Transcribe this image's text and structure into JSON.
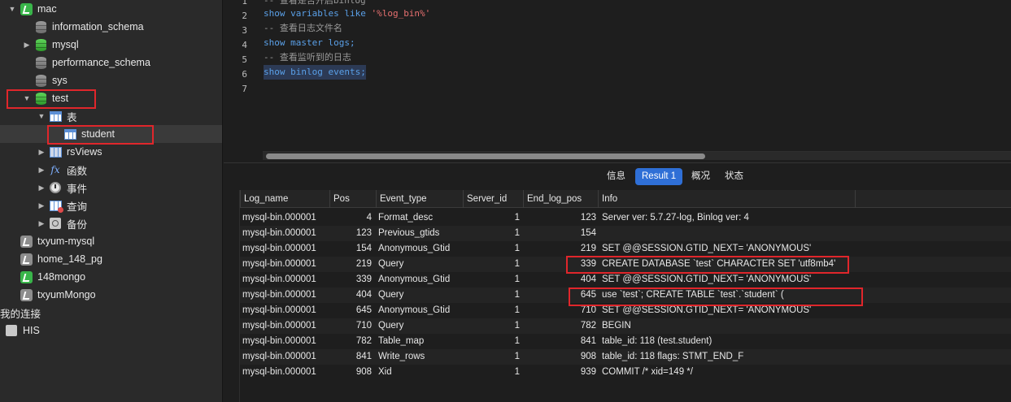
{
  "sidebar": {
    "items": [
      {
        "label": "mac",
        "disc": "▼",
        "icon": "conn-green"
      },
      {
        "label": "information_schema",
        "disc": "",
        "icon": "db-grey"
      },
      {
        "label": "mysql",
        "disc": "▶",
        "icon": "db-green"
      },
      {
        "label": "performance_schema",
        "disc": "",
        "icon": "db-grey"
      },
      {
        "label": "sys",
        "disc": "",
        "icon": "db-grey"
      },
      {
        "label": "test",
        "disc": "▼",
        "icon": "db-green"
      },
      {
        "label": "表",
        "disc": "▼",
        "icon": "table-icon"
      },
      {
        "label": "student",
        "disc": "",
        "icon": "table-icon"
      },
      {
        "label": "rsViews",
        "disc": "▶",
        "icon": "view-icon"
      },
      {
        "label": "函数",
        "disc": "▶",
        "icon": "function-icon"
      },
      {
        "label": "事件",
        "disc": "▶",
        "icon": "event-clock-icon"
      },
      {
        "label": "查询",
        "disc": "▶",
        "icon": "query-icon"
      },
      {
        "label": "备份",
        "disc": "▶",
        "icon": "backup-icon"
      },
      {
        "label": "txyum-mysql",
        "disc": "",
        "icon": "conn-grey"
      },
      {
        "label": "home_148_pg",
        "disc": "",
        "icon": "conn-grey"
      },
      {
        "label": "148mongo",
        "disc": "",
        "icon": "conn-green"
      },
      {
        "label": "txyumMongo",
        "disc": "",
        "icon": "conn-grey"
      },
      {
        "label": "我的连接",
        "disc": "",
        "icon": "none"
      },
      {
        "label": "HIS",
        "disc": "",
        "icon": "his-icon"
      }
    ]
  },
  "editor": {
    "line_numbers": [
      "1",
      "2",
      "3",
      "4",
      "5",
      "6",
      "7"
    ],
    "lines": {
      "l1": "-- 查看是否开启binlog",
      "l2_kw": "show variables like ",
      "l2_str": "'%log_bin%'",
      "l3": "-- 查看日志文件名",
      "l4": "show master logs;",
      "l5": "-- 查看监听到的日志",
      "l6": "show binlog events;"
    }
  },
  "tabs": [
    {
      "label": "信息",
      "active": false
    },
    {
      "label": "Result 1",
      "active": true
    },
    {
      "label": "概况",
      "active": false
    },
    {
      "label": "状态",
      "active": false
    }
  ],
  "result": {
    "columns": [
      "Log_name",
      "Pos",
      "Event_type",
      "Server_id",
      "End_log_pos",
      "Info"
    ],
    "rows": [
      [
        "mysql-bin.000001",
        "4",
        "Format_desc",
        "1",
        "123",
        "Server ver: 5.7.27-log, Binlog ver: 4"
      ],
      [
        "mysql-bin.000001",
        "123",
        "Previous_gtids",
        "1",
        "154",
        ""
      ],
      [
        "mysql-bin.000001",
        "154",
        "Anonymous_Gtid",
        "1",
        "219",
        "SET @@SESSION.GTID_NEXT= 'ANONYMOUS'"
      ],
      [
        "mysql-bin.000001",
        "219",
        "Query",
        "1",
        "339",
        "CREATE DATABASE `test` CHARACTER SET 'utf8mb4'"
      ],
      [
        "mysql-bin.000001",
        "339",
        "Anonymous_Gtid",
        "1",
        "404",
        "SET @@SESSION.GTID_NEXT= 'ANONYMOUS'"
      ],
      [
        "mysql-bin.000001",
        "404",
        "Query",
        "1",
        "645",
        "use `test`; CREATE TABLE `test`.`student`  ("
      ],
      [
        "mysql-bin.000001",
        "645",
        "Anonymous_Gtid",
        "1",
        "710",
        "SET @@SESSION.GTID_NEXT= 'ANONYMOUS'"
      ],
      [
        "mysql-bin.000001",
        "710",
        "Query",
        "1",
        "782",
        "BEGIN"
      ],
      [
        "mysql-bin.000001",
        "782",
        "Table_map",
        "1",
        "841",
        "table_id: 118 (test.student)"
      ],
      [
        "mysql-bin.000001",
        "841",
        "Write_rows",
        "1",
        "908",
        "table_id: 118 flags: STMT_END_F"
      ],
      [
        "mysql-bin.000001",
        "908",
        "Xid",
        "1",
        "939",
        "COMMIT /* xid=149 */"
      ]
    ]
  },
  "colors": {
    "accent": "#2f6fd6",
    "highlight_box": "#e0262b",
    "db_green": "#3fbf3a"
  }
}
